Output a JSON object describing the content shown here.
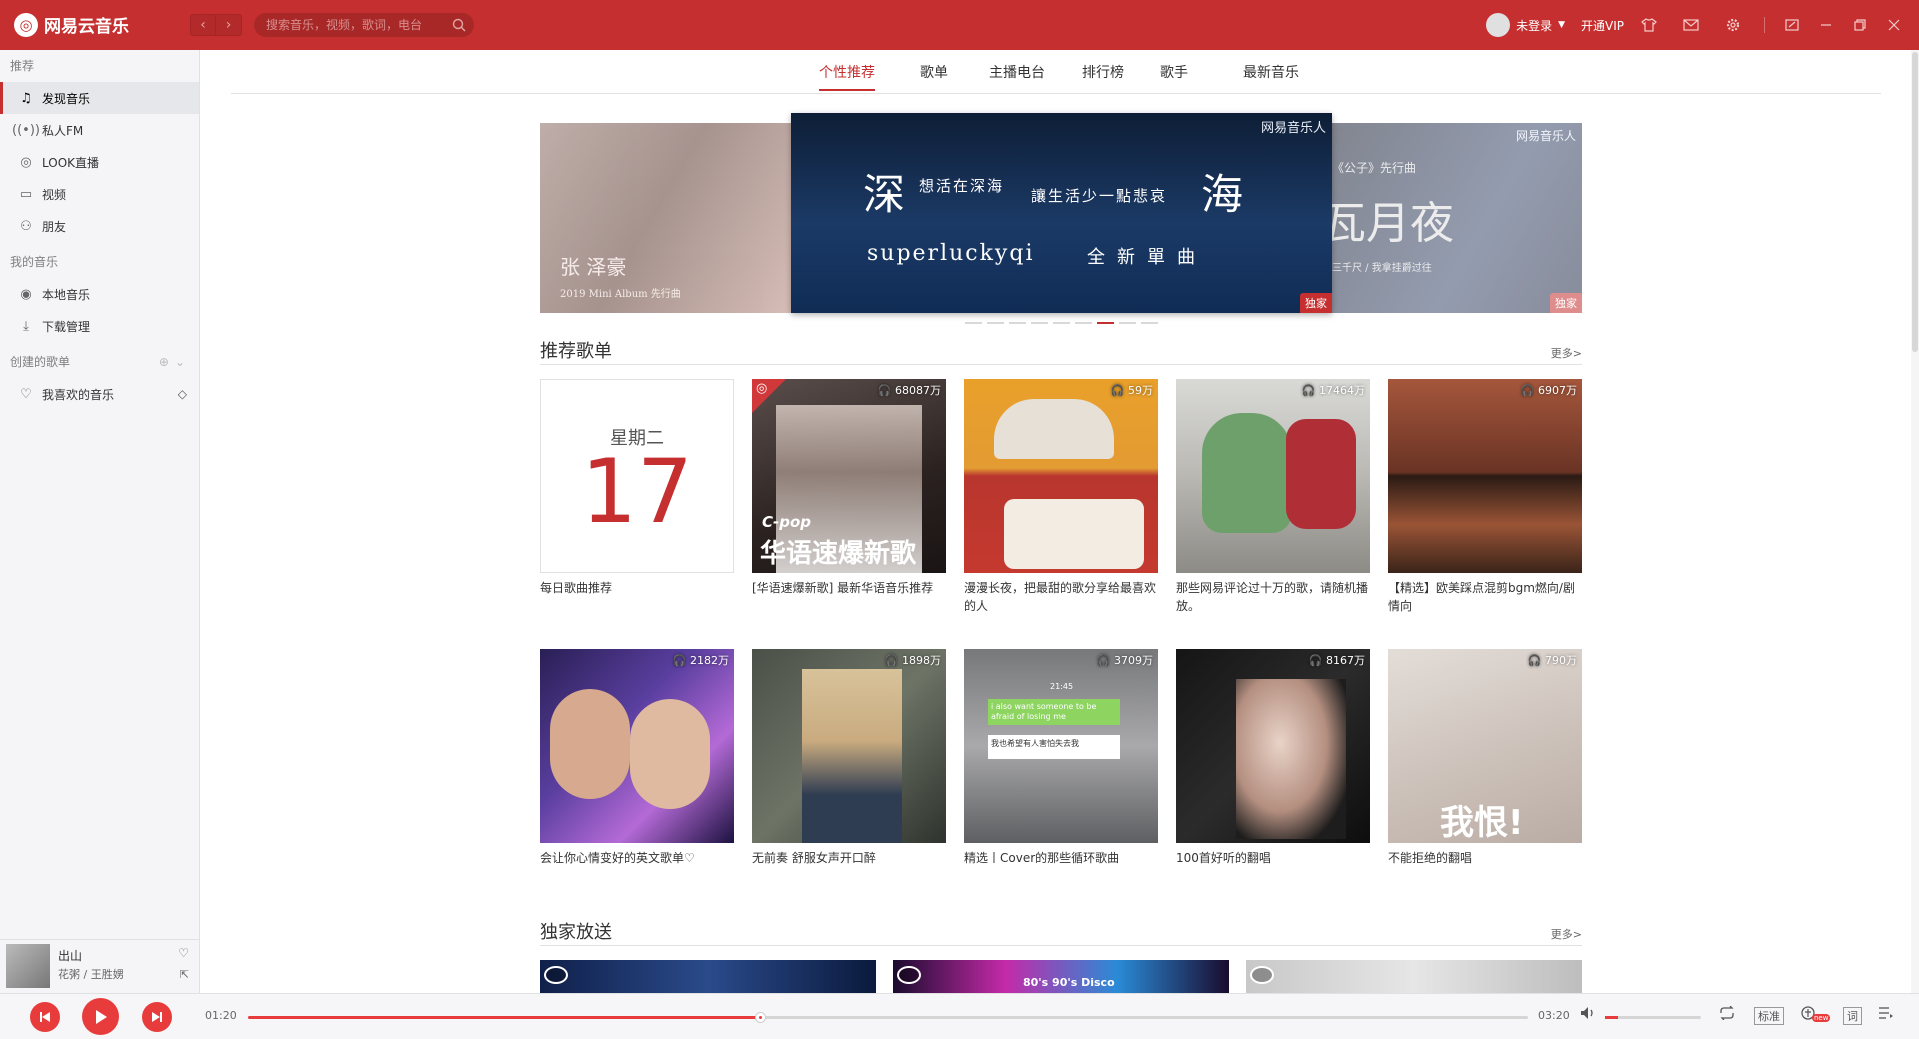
{
  "app": {
    "name": "网易云音乐",
    "brand_color": "#c62f2f"
  },
  "search": {
    "placeholder": "搜索音乐，视频，歌词，电台"
  },
  "user": {
    "login_label": "未登录",
    "vip_label": "开通VIP"
  },
  "sidebar": {
    "recommend_header": "推荐",
    "items": [
      {
        "label": "发现音乐",
        "icon": "music-note-icon"
      },
      {
        "label": "私人FM",
        "icon": "radio-waves-icon"
      },
      {
        "label": "LOOK直播",
        "icon": "live-broadcast-icon"
      },
      {
        "label": "视频",
        "icon": "video-camera-icon"
      },
      {
        "label": "朋友",
        "icon": "friends-icon"
      }
    ],
    "my_music_header": "我的音乐",
    "my_items": [
      {
        "label": "本地音乐",
        "icon": "disc-icon"
      },
      {
        "label": "下载管理",
        "icon": "download-icon"
      }
    ],
    "created_header": "创建的歌单",
    "playlists": [
      {
        "label": "我喜欢的音乐",
        "icon": "heart-icon"
      }
    ]
  },
  "now_playing": {
    "title": "出山",
    "artist": "花粥 / 王胜娚"
  },
  "tabs": [
    "个性推荐",
    "歌单",
    "主播电台",
    "排行榜",
    "歌手",
    "最新音乐"
  ],
  "banner": {
    "brand": "网易音乐人",
    "big1": "深",
    "sub1": "想活在深海",
    "sub2": "讓生活少一點悲哀",
    "big2": "海",
    "artist": "superluckyqi",
    "line2": "全新單曲",
    "badge": "独家",
    "left_name": "张 泽豪",
    "left_sub": "2019 Mini Album 先行曲",
    "right_top": "《公子》先行曲",
    "right_big": "瓦月夜",
    "right_sub": "三千尺 / 我拿挂爵过往",
    "right_badge": "独家"
  },
  "recommended": {
    "title": "推荐歌单",
    "more": "更多>",
    "daily": {
      "weekday": "星期二",
      "day": "17",
      "title": "每日歌曲推荐"
    },
    "playlists": [
      {
        "count": "68087万",
        "title": "[华语速爆新歌] 最新华语音乐推荐",
        "cover_text": "华语速爆新歌",
        "cover_tag": "C-pop"
      },
      {
        "count": "59万",
        "title": "漫漫长夜，把最甜的歌分享给最喜欢的人"
      },
      {
        "count": "17464万",
        "title": "那些网易评论过十万的歌，请随机播放。"
      },
      {
        "count": "6907万",
        "title": "【精选】欧美踩点混剪bgm燃向/剧情向"
      },
      {
        "count": "2182万",
        "title": "会让你心情变好的英文歌单♡"
      },
      {
        "count": "1898万",
        "title": "无前奏 舒服女声开口醉"
      },
      {
        "count": "3709万",
        "title": "精选丨Cover的那些循环歌曲",
        "chat1": "i also want someone to be afraid of losing me",
        "chat2": "我也希望有人害怕失去我",
        "chat_time": "21:45"
      },
      {
        "count": "8167万",
        "title": "100首好听的翻唱"
      },
      {
        "count": "790万",
        "title": "不能拒绝的翻唱",
        "cover_text": "我恨!"
      }
    ]
  },
  "exclusive": {
    "title": "独家放送",
    "more": "更多>",
    "video2_text": "80's 90's Disco"
  },
  "player": {
    "elapsed": "01:20",
    "total": "03:20",
    "progress": 0.4,
    "volume": 0.14,
    "quality": "标准",
    "lyric": "词",
    "badge": "new"
  }
}
